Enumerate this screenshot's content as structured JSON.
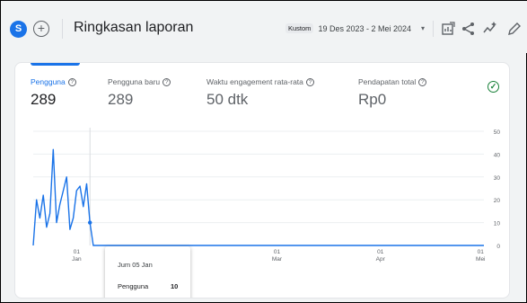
{
  "header": {
    "avatar_letter": "S",
    "add_symbol": "+",
    "title": "Ringkasan laporan",
    "date_chip": "Kustom",
    "date_range": "19 Des 2023 - 2 Mei 2024",
    "caret": "▾",
    "icons": [
      "edit-report-icon",
      "share-icon",
      "insights-icon",
      "pencil-icon"
    ]
  },
  "metrics": [
    {
      "label": "Pengguna",
      "value": "289",
      "active": true
    },
    {
      "label": "Pengguna baru",
      "value": "289",
      "active": false
    },
    {
      "label": "Waktu engagement rata-rata",
      "value": "50 dtk",
      "active": false
    },
    {
      "label": "Pendapatan total",
      "value": "Rp0",
      "active": false
    }
  ],
  "status": {
    "icon": "check-circle-icon",
    "color": "#188038"
  },
  "chart_data": {
    "type": "line",
    "y_ticks": [
      0,
      10,
      20,
      30,
      40,
      50
    ],
    "ylim": [
      0,
      50
    ],
    "x_ticks": [
      {
        "day": "01",
        "month": "Jan",
        "i": 13
      },
      {
        "day": "01",
        "month": "Feb",
        "i": 44
      },
      {
        "day": "01",
        "month": "Mar",
        "i": 73
      },
      {
        "day": "01",
        "month": "Apr",
        "i": 104
      },
      {
        "day": "01",
        "month": "Mei",
        "i": 134
      }
    ],
    "start_date": "19 Des 2023",
    "end_date": "2 Mei 2024",
    "values": [
      0,
      20,
      12,
      22,
      8,
      14,
      42,
      10,
      18,
      24,
      30,
      7,
      12,
      24,
      26,
      17,
      27,
      10,
      0,
      0,
      0,
      0,
      0,
      0,
      0,
      0,
      0,
      0,
      0,
      0,
      0,
      0,
      0,
      0,
      0,
      0,
      0,
      0,
      0,
      0,
      0,
      0,
      0,
      0,
      0,
      0,
      0,
      0,
      0,
      0,
      0,
      0,
      0,
      0,
      0,
      0,
      0,
      0,
      0,
      0,
      0,
      0,
      0,
      0,
      0,
      0,
      0,
      0,
      0,
      0,
      0,
      0,
      0,
      0,
      0,
      0,
      0,
      0,
      0,
      0,
      0,
      0,
      0,
      0,
      0,
      0,
      0,
      0,
      0,
      0,
      0,
      0,
      0,
      0,
      0,
      0,
      0,
      0,
      0,
      0,
      0,
      0,
      0,
      0,
      0,
      0,
      0,
      0,
      0,
      0,
      0,
      0,
      0,
      0,
      0,
      0,
      0,
      0,
      0,
      0,
      0,
      0,
      0,
      0,
      0,
      0,
      0,
      0,
      0,
      0,
      0,
      0,
      0,
      0,
      0,
      0
    ],
    "highlight_index": 17,
    "color": "#1a73e8"
  },
  "tooltip": {
    "date": "Jum 05 Jan",
    "label": "Pengguna",
    "value": "10"
  }
}
